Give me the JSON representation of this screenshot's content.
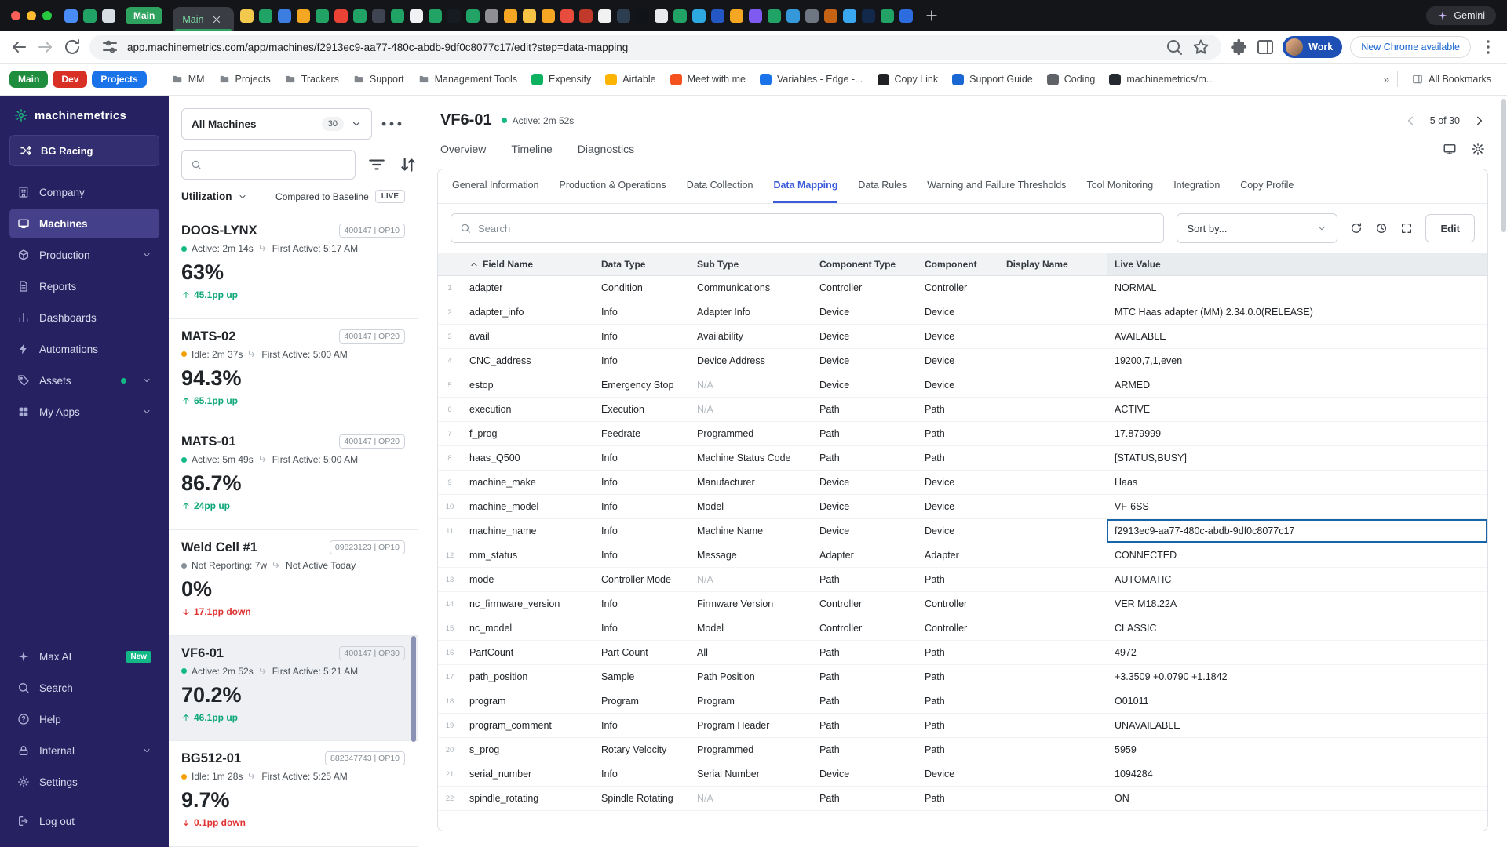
{
  "colors": {
    "accent_green": "#12b886",
    "accent_blue": "#3b5bdb",
    "delta_up": "#0ca678",
    "delta_down": "#e03131",
    "sidebar_bg": "#262262",
    "selected_cell_border": "#1864ab"
  },
  "menubar": {
    "window_controls": [
      "#ff5f57",
      "#febc2e",
      "#28c840"
    ],
    "pinned_before": [
      "#4a8cf7",
      "#21a366",
      "#d8dde3"
    ],
    "tab_group_label": "Main",
    "active_tab": {
      "label": "Main"
    },
    "pinned_after": [
      "#f2c94c",
      "#21a366",
      "#3b7de0",
      "#f5a623",
      "#21a366",
      "#ea4335",
      "#21a366",
      "#3e4451",
      "#21a366",
      "#f0f2f4",
      "#21a366",
      "#161b22",
      "#21a366",
      "#8e8e93",
      "#f5a623",
      "#f6c344",
      "#f5a623",
      "#e74c3c",
      "#c0392b",
      "#f2f2f2",
      "#2c3e50",
      "#101418",
      "#e8eaed",
      "#21a366",
      "#2ea9df",
      "#2456c4",
      "#f5a623",
      "#7f5af0",
      "#21a366",
      "#3498db",
      "#6e7681",
      "#c56315",
      "#3aa8f0",
      "#13294b",
      "#21a366",
      "#2d6cdf"
    ],
    "assistant_label": "Gemini"
  },
  "toolbar": {
    "url": "app.machinemetrics.com/app/machines/f2913ec9-aa77-480c-abdb-9df0c8077c17/edit?step=data-mapping",
    "profile_label": "Work",
    "update_label": "New Chrome available"
  },
  "bookmarks_bar": {
    "groups": [
      {
        "label": "Main",
        "color": "#1e8e3e"
      },
      {
        "label": "Dev",
        "color": "#d93025"
      },
      {
        "label": "Projects",
        "color": "#1a73e8"
      }
    ],
    "folders": [
      "MM",
      "Projects",
      "Trackers",
      "Support",
      "Management Tools"
    ],
    "sites": [
      {
        "label": "Expensify",
        "color": "#0bb15e"
      },
      {
        "label": "Airtable",
        "color": "#fcb400"
      },
      {
        "label": "Meet with me",
        "color": "#f4511e"
      },
      {
        "label": "Variables - Edge -...",
        "color": "#1a73e8"
      },
      {
        "label": "Copy Link",
        "color": "#202124"
      },
      {
        "label": "Support Guide",
        "color": "#1967d2"
      },
      {
        "label": "Coding",
        "color": "#5f6368"
      },
      {
        "label": "machinemetrics/m...",
        "color": "#24292f"
      }
    ],
    "overflow_label": "»",
    "all_bookmarks_label": "All Bookmarks"
  },
  "sidebar": {
    "brand": "machinemetrics",
    "org": "BG Racing",
    "items": [
      {
        "label": "Company",
        "icon": "building"
      },
      {
        "label": "Machines",
        "icon": "monitor",
        "active": true
      },
      {
        "label": "Production",
        "icon": "cube",
        "chevron": true
      },
      {
        "label": "Reports",
        "icon": "doc"
      },
      {
        "label": "Dashboards",
        "icon": "bars"
      },
      {
        "label": "Automations",
        "icon": "bolt"
      },
      {
        "label": "Assets",
        "icon": "tag",
        "chevron": true,
        "dot": true
      },
      {
        "label": "My Apps",
        "icon": "apps",
        "chevron": true
      }
    ],
    "bottom_items": [
      {
        "label": "Max AI",
        "icon": "sparkle",
        "badge": "New"
      },
      {
        "label": "Search",
        "icon": "search"
      },
      {
        "label": "Help",
        "icon": "help"
      },
      {
        "label": "Internal",
        "icon": "lock",
        "chevron": true
      },
      {
        "label": "Settings",
        "icon": "gear"
      },
      {
        "label": "Log out",
        "icon": "logout",
        "logout": true
      }
    ]
  },
  "machine_list": {
    "selector_label": "All Machines",
    "selector_count": "30",
    "metric_label": "Utilization",
    "compare_label": "Compared to Baseline",
    "live_badge": "LIVE",
    "cards": [
      {
        "name": "DOOS-LYNX",
        "badge": "400147 | OP10",
        "status": "Active: 2m 14s",
        "status_color": "#12b886",
        "first_active": "First Active: 5:17 AM",
        "value": "63%",
        "delta": "45.1pp up",
        "direction": "up"
      },
      {
        "name": "MATS-02",
        "badge": "400147 | OP20",
        "status": "Idle: 2m 37s",
        "status_color": "#f59f00",
        "first_active": "First Active: 5:00 AM",
        "value": "94.3%",
        "delta": "65.1pp up",
        "direction": "up"
      },
      {
        "name": "MATS-01",
        "badge": "400147 | OP20",
        "status": "Active: 5m 49s",
        "status_color": "#12b886",
        "first_active": "First Active: 5:00 AM",
        "value": "86.7%",
        "delta": "24pp up",
        "direction": "up"
      },
      {
        "name": "Weld Cell #1",
        "badge": "09823123 | OP10",
        "status": "Not Reporting: 7w",
        "status_color": "#868e96",
        "first_active": "Not Active Today",
        "value": "0%",
        "delta": "17.1pp down",
        "direction": "down"
      },
      {
        "name": "VF6-01",
        "badge": "400147 | OP30",
        "status": "Active: 2m 52s",
        "status_color": "#12b886",
        "first_active": "First Active: 5:21 AM",
        "value": "70.2%",
        "delta": "46.1pp up",
        "direction": "up",
        "selected": true
      },
      {
        "name": "BG512-01",
        "badge": "882347743 | OP10",
        "status": "Idle: 1m 28s",
        "status_color": "#f59f00",
        "first_active": "First Active: 5:25 AM",
        "value": "9.7%",
        "delta": "0.1pp down",
        "direction": "down"
      }
    ]
  },
  "main": {
    "machine_name": "VF6-01",
    "machine_status": "Active: 2m 52s",
    "pager": "5 of 30",
    "tabs": [
      "Overview",
      "Timeline",
      "Diagnostics"
    ],
    "settings_tabs": [
      {
        "label": "General Information"
      },
      {
        "label": "Production & Operations"
      },
      {
        "label": "Data Collection"
      },
      {
        "label": "Data Mapping",
        "active": true
      },
      {
        "label": "Data Rules"
      },
      {
        "label": "Warning and Failure Thresholds"
      },
      {
        "label": "Tool Monitoring"
      },
      {
        "label": "Integration"
      },
      {
        "label": "Copy Profile"
      }
    ],
    "toolbar": {
      "search_placeholder": "Search",
      "sort_label": "Sort by...",
      "edit_label": "Edit"
    }
  },
  "table": {
    "columns": [
      "Field Name",
      "Data Type",
      "Sub Type",
      "Component Type",
      "Component",
      "Display Name",
      "Live Value"
    ],
    "sorted_column": "Field Name",
    "rows": [
      {
        "num": 1,
        "field": "adapter",
        "data_type": "Condition",
        "sub_type": "Communications",
        "component_type": "Controller",
        "component": "Controller",
        "display_name": "",
        "live_value": "NORMAL"
      },
      {
        "num": 2,
        "field": "adapter_info",
        "data_type": "Info",
        "sub_type": "Adapter Info",
        "component_type": "Device",
        "component": "Device",
        "display_name": "",
        "live_value": "MTC Haas adapter (MM) 2.34.0.0(RELEASE)"
      },
      {
        "num": 3,
        "field": "avail",
        "data_type": "Info",
        "sub_type": "Availability",
        "component_type": "Device",
        "component": "Device",
        "display_name": "",
        "live_value": "AVAILABLE"
      },
      {
        "num": 4,
        "field": "CNC_address",
        "data_type": "Info",
        "sub_type": "Device Address",
        "component_type": "Device",
        "component": "Device",
        "display_name": "",
        "live_value": "19200,7,1,even"
      },
      {
        "num": 5,
        "field": "estop",
        "data_type": "Emergency Stop",
        "sub_type": "N/A",
        "na": true,
        "component_type": "Device",
        "component": "Device",
        "display_name": "",
        "live_value": "ARMED"
      },
      {
        "num": 6,
        "field": "execution",
        "data_type": "Execution",
        "sub_type": "N/A",
        "na": true,
        "component_type": "Path",
        "component": "Path",
        "display_name": "",
        "live_value": "ACTIVE"
      },
      {
        "num": 7,
        "field": "f_prog",
        "data_type": "Feedrate",
        "sub_type": "Programmed",
        "component_type": "Path",
        "component": "Path",
        "display_name": "",
        "live_value": "17.879999"
      },
      {
        "num": 8,
        "field": "haas_Q500",
        "data_type": "Info",
        "sub_type": "Machine Status Code",
        "component_type": "Path",
        "component": "Path",
        "display_name": "",
        "live_value": "[STATUS,BUSY]"
      },
      {
        "num": 9,
        "field": "machine_make",
        "data_type": "Info",
        "sub_type": "Manufacturer",
        "component_type": "Device",
        "component": "Device",
        "display_name": "",
        "live_value": "Haas"
      },
      {
        "num": 10,
        "field": "machine_model",
        "data_type": "Info",
        "sub_type": "Model",
        "component_type": "Device",
        "component": "Device",
        "display_name": "",
        "live_value": "VF-6SS"
      },
      {
        "num": 11,
        "field": "machine_name",
        "data_type": "Info",
        "sub_type": "Machine Name",
        "component_type": "Device",
        "component": "Device",
        "display_name": "",
        "live_value": "f2913ec9-aa77-480c-abdb-9df0c8077c17",
        "selected": true
      },
      {
        "num": 12,
        "field": "mm_status",
        "data_type": "Info",
        "sub_type": "Message",
        "component_type": "Adapter",
        "component": "Adapter",
        "display_name": "",
        "live_value": "CONNECTED"
      },
      {
        "num": 13,
        "field": "mode",
        "data_type": "Controller Mode",
        "sub_type": "N/A",
        "na": true,
        "component_type": "Path",
        "component": "Path",
        "display_name": "",
        "live_value": "AUTOMATIC"
      },
      {
        "num": 14,
        "field": "nc_firmware_version",
        "data_type": "Info",
        "sub_type": "Firmware Version",
        "component_type": "Controller",
        "component": "Controller",
        "display_name": "",
        "live_value": "VER M18.22A"
      },
      {
        "num": 15,
        "field": "nc_model",
        "data_type": "Info",
        "sub_type": "Model",
        "component_type": "Controller",
        "component": "Controller",
        "display_name": "",
        "live_value": "CLASSIC"
      },
      {
        "num": 16,
        "field": "PartCount",
        "data_type": "Part Count",
        "sub_type": "All",
        "component_type": "Path",
        "component": "Path",
        "display_name": "",
        "live_value": "4972"
      },
      {
        "num": 17,
        "field": "path_position",
        "data_type": "Sample",
        "sub_type": "Path Position",
        "component_type": "Path",
        "component": "Path",
        "display_name": "",
        "live_value": "+3.3509 +0.0790 +1.1842"
      },
      {
        "num": 18,
        "field": "program",
        "data_type": "Program",
        "sub_type": "Program",
        "component_type": "Path",
        "component": "Path",
        "display_name": "",
        "live_value": "O01011"
      },
      {
        "num": 19,
        "field": "program_comment",
        "data_type": "Info",
        "sub_type": "Program Header",
        "component_type": "Path",
        "component": "Path",
        "display_name": "",
        "live_value": "UNAVAILABLE"
      },
      {
        "num": 20,
        "field": "s_prog",
        "data_type": "Rotary Velocity",
        "sub_type": "Programmed",
        "component_type": "Path",
        "component": "Path",
        "display_name": "",
        "live_value": "5959"
      },
      {
        "num": 21,
        "field": "serial_number",
        "data_type": "Info",
        "sub_type": "Serial Number",
        "component_type": "Device",
        "component": "Device",
        "display_name": "",
        "live_value": "1094284"
      },
      {
        "num": 22,
        "field": "spindle_rotating",
        "data_type": "Spindle Rotating",
        "sub_type": "N/A",
        "na": true,
        "component_type": "Path",
        "component": "Path",
        "display_name": "",
        "live_value": "ON"
      }
    ]
  }
}
